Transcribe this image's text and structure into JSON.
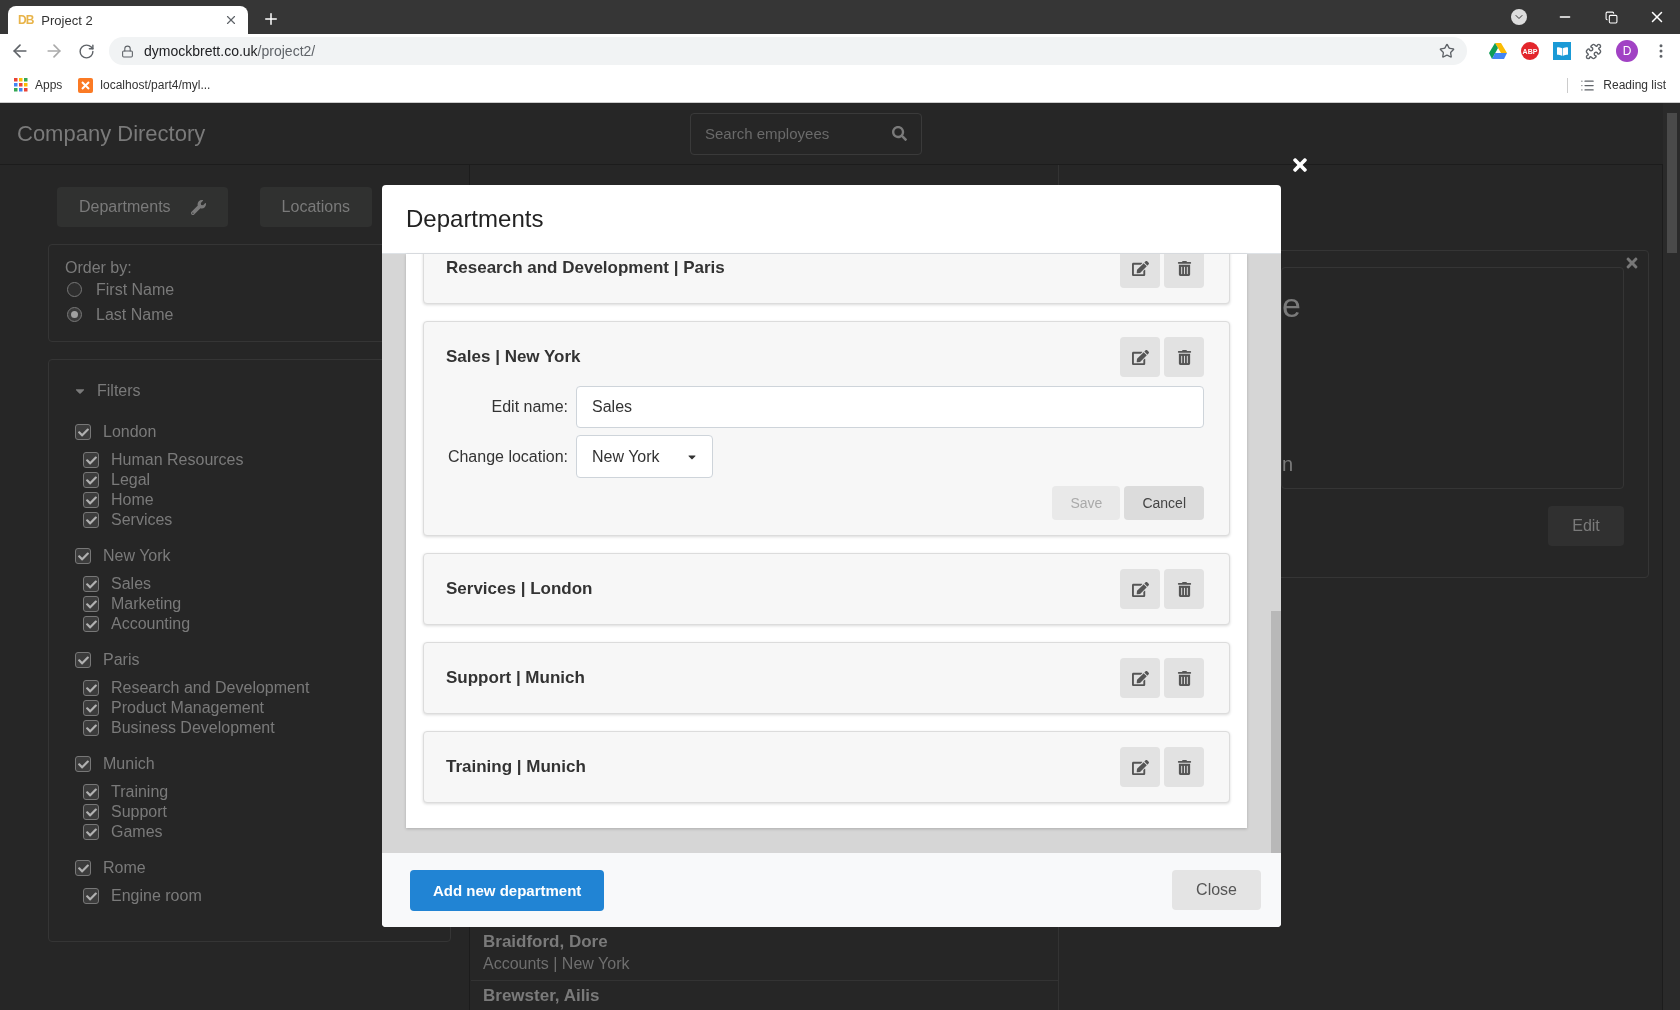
{
  "browser": {
    "favicon": "DB",
    "tab_title": "Project 2",
    "url_host": "dymockbrett.co.uk",
    "url_path": "/project2/",
    "bookmarks": [
      {
        "label": "Apps",
        "kind": "apps"
      },
      {
        "label": "localhost/part4/myl...",
        "kind": "site"
      }
    ],
    "abp_label": "ABP",
    "profile_initial": "D",
    "reading_list": "Reading list"
  },
  "page": {
    "title": "Company Directory",
    "search_placeholder": "Search employees",
    "nav_buttons": [
      "Departments",
      "Locations"
    ],
    "order_by": {
      "label": "Order by:",
      "options": [
        {
          "label": "First Name",
          "selected": false
        },
        {
          "label": "Last Name",
          "selected": true
        }
      ]
    },
    "filters": {
      "label": "Filters",
      "expanded": true,
      "locations": [
        {
          "label": "London",
          "checked": true,
          "children": [
            {
              "label": "Human Resources",
              "checked": true
            },
            {
              "label": "Legal",
              "checked": true
            },
            {
              "label": "Home",
              "checked": true
            },
            {
              "label": "Services",
              "checked": true
            }
          ]
        },
        {
          "label": "New York",
          "checked": true,
          "children": [
            {
              "label": "Sales",
              "checked": true
            },
            {
              "label": "Marketing",
              "checked": true
            },
            {
              "label": "Accounting",
              "checked": true
            }
          ]
        },
        {
          "label": "Paris",
          "checked": true,
          "children": [
            {
              "label": "Research and Development",
              "checked": true
            },
            {
              "label": "Product Management",
              "checked": true
            },
            {
              "label": "Business Development",
              "checked": true
            }
          ]
        },
        {
          "label": "Munich",
          "checked": true,
          "children": [
            {
              "label": "Training",
              "checked": true
            },
            {
              "label": "Support",
              "checked": true
            },
            {
              "label": "Games",
              "checked": true
            }
          ]
        },
        {
          "label": "Rome",
          "checked": true,
          "children": [
            {
              "label": "Engine room",
              "checked": true
            }
          ]
        }
      ]
    },
    "employees": [
      {
        "name": "Braidford, Dore",
        "detail": "Accounts | New York"
      },
      {
        "name": "Brewster, Ailis"
      }
    ],
    "detail_card": {
      "title_fragment": "e",
      "text_fragment": "n",
      "edit_button": "Edit"
    }
  },
  "modal": {
    "title": "Departments",
    "departments": [
      {
        "name": "Research and Development | Paris",
        "expanded": false
      },
      {
        "name": "Sales | New York",
        "expanded": true,
        "edit_name_label": "Edit name:",
        "edit_name_value": "Sales",
        "location_label": "Change location:",
        "location_value": "New York",
        "save_button": "Save",
        "save_disabled": true,
        "cancel_button": "Cancel"
      },
      {
        "name": "Services | London",
        "expanded": false
      },
      {
        "name": "Support | Munich",
        "expanded": false
      },
      {
        "name": "Training | Munich",
        "expanded": false
      }
    ],
    "add_button": "Add new department",
    "close_button": "Close"
  }
}
